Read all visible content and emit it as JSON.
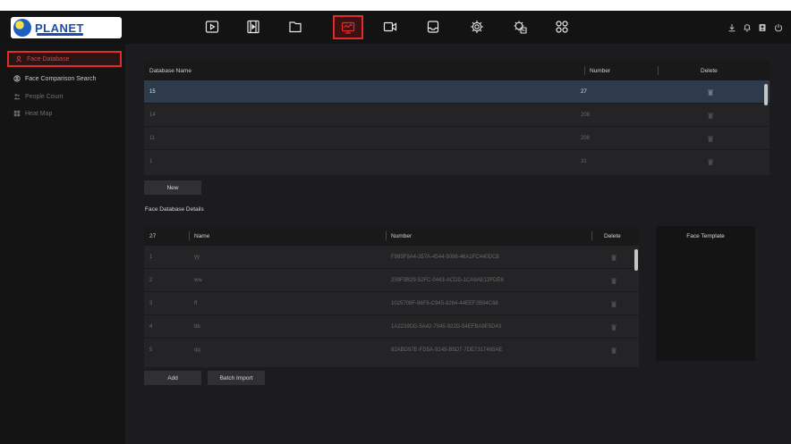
{
  "brand": {
    "logo_text": "PLANET"
  },
  "nav": {
    "icons": [
      {
        "name": "playback-icon"
      },
      {
        "name": "video-clip-icon"
      },
      {
        "name": "file-folder-icon"
      },
      {
        "name": "smart-analytics-icon",
        "active": true
      },
      {
        "name": "camera-icon"
      },
      {
        "name": "storage-tray-icon"
      },
      {
        "name": "settings-gear-icon"
      },
      {
        "name": "system-maintenance-icon"
      },
      {
        "name": "app-grid-icon"
      }
    ],
    "right_icons": [
      "download-icon",
      "alarm-bell-icon",
      "user-account-icon",
      "power-icon"
    ]
  },
  "sidebar": {
    "items": [
      {
        "label": "Face Database",
        "icon": "face-icon",
        "active": true
      },
      {
        "label": "Face Comparison Search",
        "icon": "face-search-icon"
      },
      {
        "label": "People Count",
        "icon": "people-count-icon",
        "dim": true
      },
      {
        "label": "Heat Map",
        "icon": "heat-map-icon",
        "dim": true
      }
    ]
  },
  "database_table": {
    "headers": {
      "name": "Database Name",
      "number": "Number",
      "delete": "Delete"
    },
    "rows": [
      {
        "name": "15",
        "number": "27",
        "selected": true
      },
      {
        "name": "14",
        "number": "208"
      },
      {
        "name": "11",
        "number": "208"
      },
      {
        "name": "1",
        "number": "31"
      }
    ],
    "new_button": "New"
  },
  "details": {
    "title": "Face Database Details",
    "headers": {
      "count": "27",
      "name": "Name",
      "number": "Number",
      "delete": "Delete"
    },
    "rows": [
      {
        "index": "1",
        "name": "yy",
        "number": "F995F9A4-357A-4544-9098-46A1FC440DC8"
      },
      {
        "index": "2",
        "name": "ww",
        "number": "259F9B29-52FC-0443-ACDD-1CA9AE13FDE8"
      },
      {
        "index": "3",
        "name": "ff",
        "number": "1025708F-96F8-C945-8264-44EEF2B94C68"
      },
      {
        "index": "4",
        "name": "bb",
        "number": "1A2239DD-5A42-7045-922D-54EFBA9E5D43"
      },
      {
        "index": "5",
        "name": "qq",
        "number": "82ABD97E-FD5A-9149-B5D7-7DE7317485AE"
      }
    ],
    "add_button": "Add",
    "batch_import_button": "Batch Import"
  },
  "face_template": {
    "label": "Face Template"
  },
  "colors": {
    "accent_red": "#e22b2b",
    "selected_row": "#2d3b4a",
    "background": "#1c1c1e"
  }
}
